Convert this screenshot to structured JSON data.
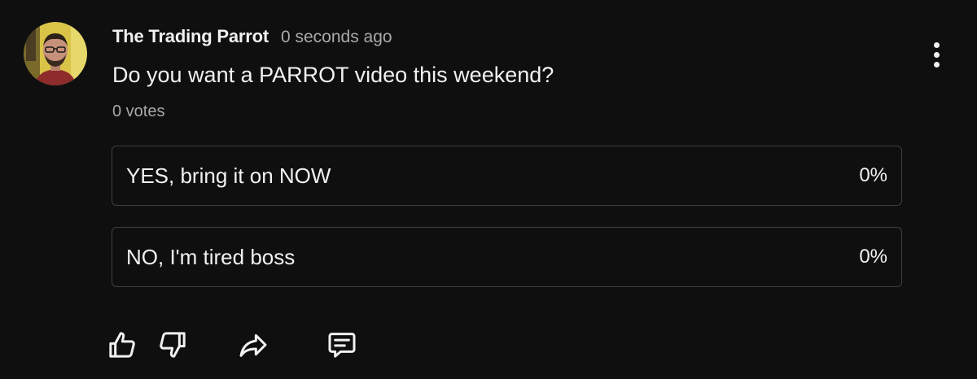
{
  "post": {
    "channel_name": "The Trading Parrot",
    "timestamp": "0 seconds ago",
    "avatar": "channel-avatar",
    "menu_icon": "more-vertical-icon"
  },
  "poll": {
    "question": "Do you want a PARROT video this weekend?",
    "votes": "0 votes",
    "options": [
      {
        "label": "YES, bring it on NOW",
        "percent": "0%"
      },
      {
        "label": "NO, I'm tired boss",
        "percent": "0%"
      }
    ]
  },
  "actions": {
    "icons": [
      "thumb-up-icon",
      "thumb-down-icon",
      "share-icon",
      "comment-icon"
    ]
  },
  "colors": {
    "background": "#0f0f0f",
    "text_primary": "#f1f1f1",
    "text_secondary": "#aaaaaa",
    "option_border": "#3f3f3f"
  }
}
